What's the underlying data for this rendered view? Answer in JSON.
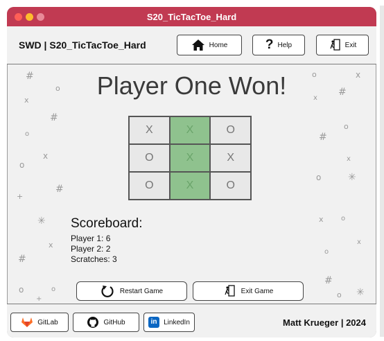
{
  "window": {
    "title": "S20_TicTacToe_Hard"
  },
  "header": {
    "app_title": "SWD | S20_TicTacToe_Hard",
    "home_label": "Home",
    "help_label": "Help",
    "exit_label": "Exit"
  },
  "game": {
    "status": "Player One Won!",
    "board": {
      "cells": [
        "X",
        "X",
        "O",
        "O",
        "X",
        "X",
        "O",
        "X",
        "O"
      ],
      "winning_cells": [
        1,
        4,
        7
      ]
    },
    "scoreboard": {
      "title": "Scoreboard:",
      "player1": "Player 1: 6",
      "player2": "Player 2: 2",
      "scratches": "Scratches: 3"
    },
    "restart_label": "Restart Game",
    "exit_game_label": "Exit Game"
  },
  "footer": {
    "gitlab_label": "GitLab",
    "github_label": "GitHub",
    "linkedin_label": "LinkedIn",
    "author": "Matt Krueger | 2024"
  },
  "colors": {
    "titlebar": "#c13a52",
    "win_cell": "#8fc28e",
    "gitlab": "#fc6d26",
    "linkedin": "#0a66c2"
  }
}
